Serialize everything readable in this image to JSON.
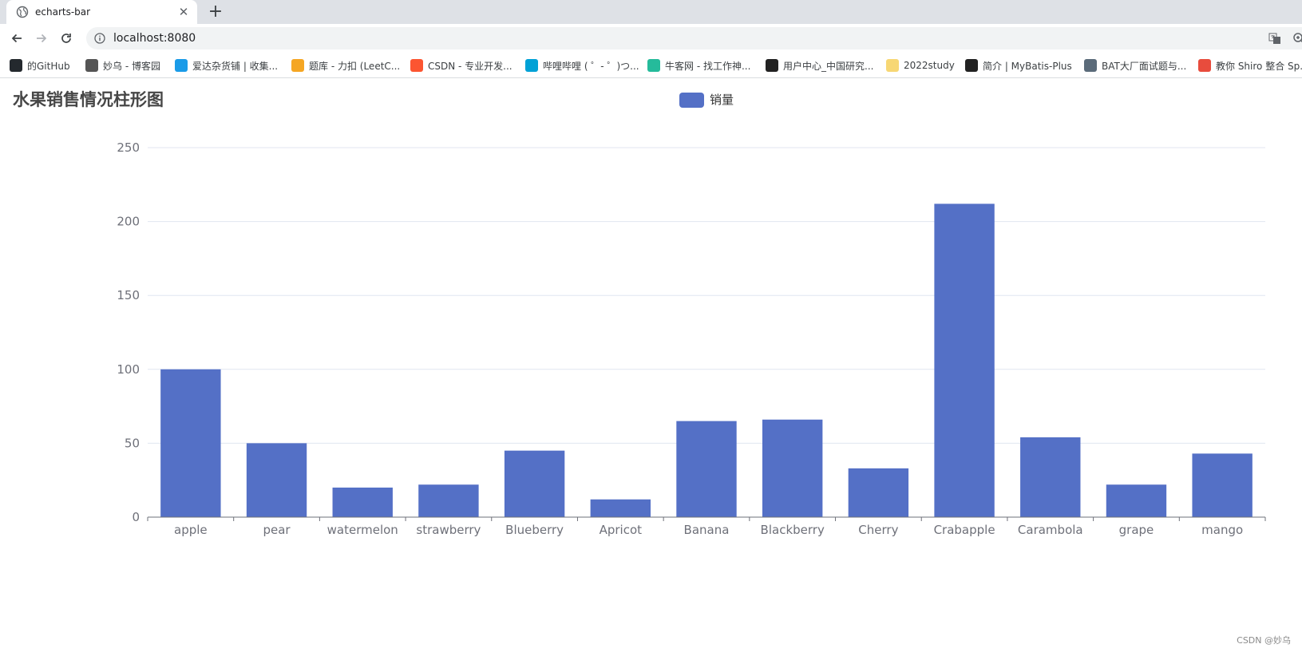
{
  "browser": {
    "tab_title": "echarts-bar",
    "url": "localhost:8080",
    "bookmarks": [
      {
        "label": "的GitHub",
        "icon": "github-icon",
        "color": "#24292e"
      },
      {
        "label": "妙乌 - 博客园",
        "icon": "cnblogs-icon",
        "color": "#555555"
      },
      {
        "label": "爱达杂货铺 | 收集...",
        "icon": "aida-icon",
        "color": "#1a9be8"
      },
      {
        "label": "题库 - 力扣 (LeetC...",
        "icon": "leetcode-icon",
        "color": "#f5a623"
      },
      {
        "label": "CSDN - 专业开发...",
        "icon": "csdn-icon",
        "color": "#fc5531"
      },
      {
        "label": "哔哩哔哩 ( ゜- ゜)つ...",
        "icon": "bilibili-icon",
        "color": "#00a1d6"
      },
      {
        "label": "牛客网 - 找工作神...",
        "icon": "nowcoder-icon",
        "color": "#25bb9b"
      },
      {
        "label": "用户中心_中国研究...",
        "icon": "graduation-cap-icon",
        "color": "#222222"
      },
      {
        "label": "2022study",
        "icon": "folder-icon",
        "color": "#f7d774"
      },
      {
        "label": "简介 | MyBatis-Plus",
        "icon": "mybatis-icon",
        "color": "#222222"
      },
      {
        "label": "BAT大厂面试题与...",
        "icon": "book-icon",
        "color": "#5b6b7a"
      },
      {
        "label": "教你 Shiro 整合 Sp...",
        "icon": "jian-icon",
        "color": "#e84c3d"
      }
    ]
  },
  "page": {
    "title": "水果销售情况柱形图",
    "watermark": "CSDN @妙乌"
  },
  "chart_data": {
    "type": "bar",
    "title": "水果销售情况柱形图",
    "legend_position": "top-center",
    "grid": true,
    "color": "#5470c6",
    "categories": [
      "apple",
      "pear",
      "watermelon",
      "strawberry",
      "Blueberry",
      "Apricot",
      "Banana",
      "Blackberry",
      "Cherry",
      "Crabapple",
      "Carambola",
      "grape",
      "mango"
    ],
    "series": [
      {
        "name": "销量",
        "values": [
          100,
          50,
          20,
          22,
          45,
          12,
          65,
          66,
          33,
          212,
          54,
          22,
          43
        ]
      }
    ],
    "ylim": [
      0,
      250
    ],
    "yticks": [
      0,
      50,
      100,
      150,
      200,
      250
    ]
  }
}
